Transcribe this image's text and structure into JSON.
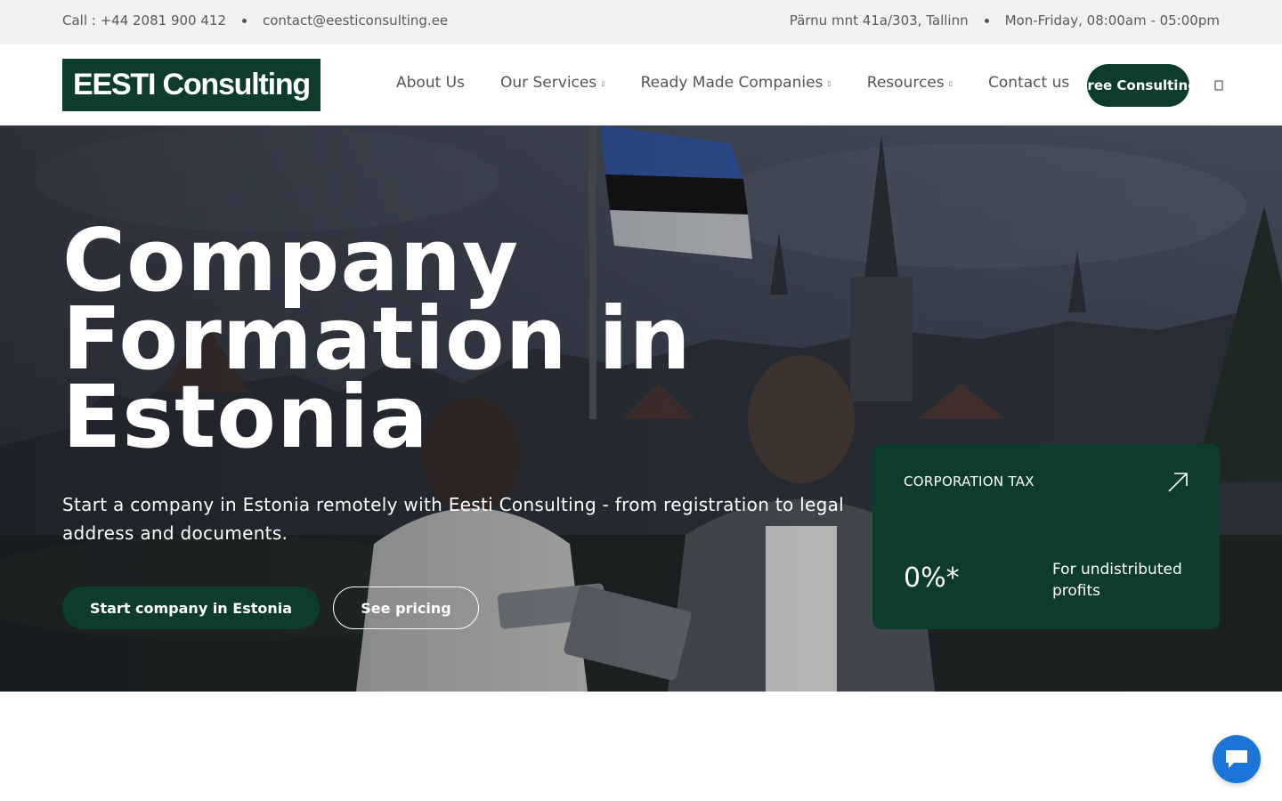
{
  "topbar": {
    "phone": "Call : +44 2081 900 412",
    "email": "contact@eesticonsulting.ee",
    "address": "Pärnu mnt 41a/303, Tallinn",
    "hours": "Mon-Friday, 08:00am - 05:00pm"
  },
  "header": {
    "logo_text": "EESTI Consulting",
    "nav": [
      {
        "label": "About Us",
        "has_dropdown": false
      },
      {
        "label": "Our Services",
        "has_dropdown": true
      },
      {
        "label": "Ready Made Companies",
        "has_dropdown": true
      },
      {
        "label": "Resources",
        "has_dropdown": true
      },
      {
        "label": "Contact us",
        "has_dropdown": false
      }
    ],
    "cta_label": "Free Consulting",
    "search_icon": "search-icon"
  },
  "hero": {
    "title": "Company Formation in Estonia",
    "subtitle": "Start a company in Estonia remotely with Eesti Consulting - from registration to legal address and documents.",
    "primary_button": "Start company in Estonia",
    "secondary_button": "See pricing",
    "tax_card": {
      "label": "CORPORATION TAX",
      "value": "0%*",
      "description": "For undistributed profits",
      "icon": "arrow-up-right-icon"
    }
  },
  "chat": {
    "icon": "chat-bubble-icon"
  },
  "colors": {
    "brand_green": "#0d3b2c",
    "topbar_bg": "#f3f2f1",
    "chat_blue": "#1b74d8"
  }
}
